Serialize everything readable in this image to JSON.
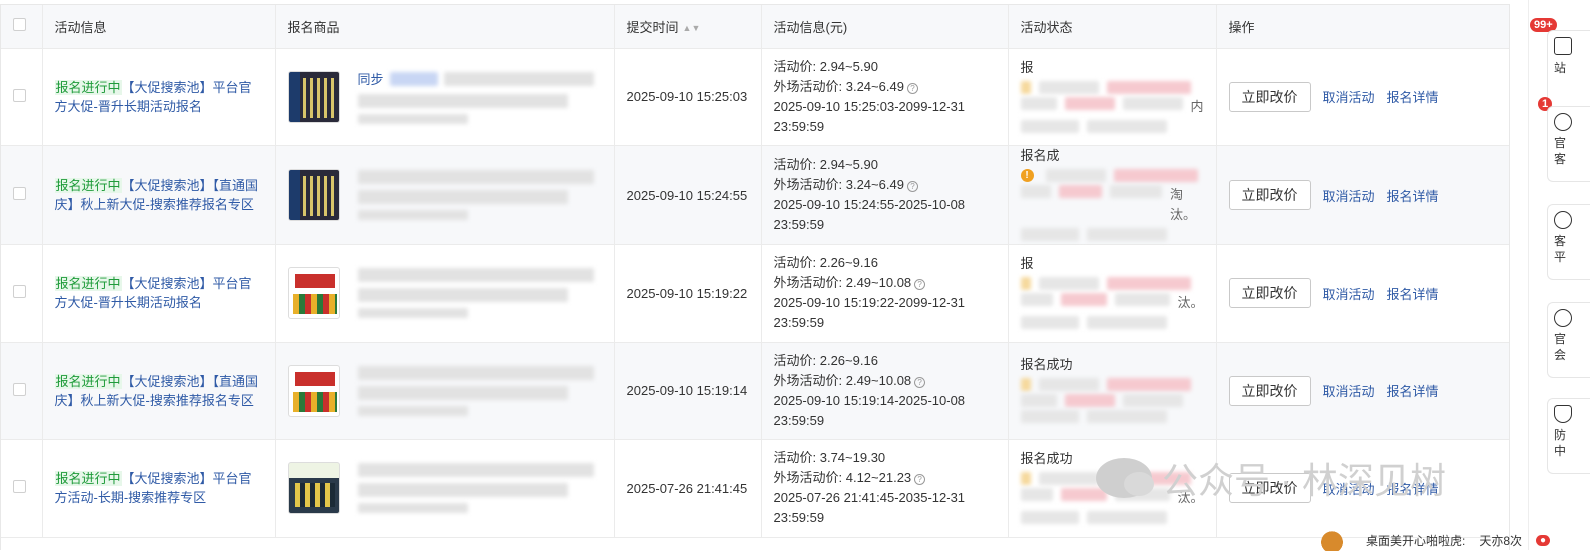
{
  "table": {
    "headers": {
      "activity_info": "活动信息",
      "product": "报名商品",
      "submit_time": "提交时间",
      "activity_price": "活动信息(元)",
      "status": "活动状态",
      "actions": "操作"
    },
    "rows": [
      {
        "tag": "报名进行中",
        "activity": "【大促搜索池】平台官方大促-晋升长期活动报名",
        "product_title_visible": "同步",
        "submit_time": "2025-09-10 15:25:03",
        "price_line": "活动价: 2.94~5.90",
        "outside_price": "外场活动价: 3.24~6.49",
        "period": "2025-09-10 15:25:03-2099-12-31 23:59:59",
        "status_text": "报",
        "status_tail": "内",
        "thumb": "t1",
        "warn": false
      },
      {
        "tag": "报名进行中",
        "activity": "【大促搜索池】【直通国庆】秋上新大促-搜索推荐报名专区",
        "product_title_visible": "",
        "submit_time": "2025-09-10 15:24:55",
        "price_line": "活动价: 2.94~5.90",
        "outside_price": "外场活动价: 3.24~6.49",
        "period": "2025-09-10 15:24:55-2025-10-08 23:59:59",
        "status_text": "报名成",
        "status_tail": "淘汰。",
        "thumb": "t1",
        "warn": true
      },
      {
        "tag": "报名进行中",
        "activity": "【大促搜索池】平台官方大促-晋升长期活动报名",
        "product_title_visible": "",
        "submit_time": "2025-09-10 15:19:22",
        "price_line": "活动价: 2.26~9.16",
        "outside_price": "外场活动价: 2.49~10.08",
        "period": "2025-09-10 15:19:22-2099-12-31 23:59:59",
        "status_text": "报",
        "status_tail": "汰。",
        "thumb": "t2",
        "warn": false
      },
      {
        "tag": "报名进行中",
        "activity": "【大促搜索池】【直通国庆】秋上新大促-搜索推荐报名专区",
        "product_title_visible": "",
        "submit_time": "2025-09-10 15:19:14",
        "price_line": "活动价: 2.26~9.16",
        "outside_price": "外场活动价: 2.49~10.08",
        "period": "2025-09-10 15:19:14-2025-10-08 23:59:59",
        "status_text": "报名成功",
        "status_tail": "",
        "thumb": "t2",
        "warn": false
      },
      {
        "tag": "报名进行中",
        "activity": "【大促搜索池】平台官方活动-长期-搜索推荐专区",
        "product_title_visible": "",
        "submit_time": "2025-07-26 21:41:45",
        "price_line": "活动价: 3.74~19.30",
        "outside_price": "外场活动价: 4.12~21.23",
        "period": "2025-07-26 21:41:45-2035-12-31 23:59:59",
        "status_text": "报名成功",
        "status_tail": "汰。",
        "thumb": "t3",
        "warn": false
      }
    ],
    "actions": {
      "change_price": "立即改价",
      "cancel": "取消活动",
      "details": "报名详情"
    }
  },
  "sidebar": {
    "badge_top": "99+",
    "badge_second": "1",
    "items": [
      "站",
      "官\n客",
      "客\n平",
      "官\n会",
      "防\n中"
    ]
  },
  "watermark": {
    "text": "公众号 · 林深见树"
  },
  "bottom_strip": {
    "text": "桌面美开心啪啦虎:",
    "count": "天亦8次"
  },
  "colors": {
    "link": "#2f5aa6",
    "tag_green": "#1f9b3a",
    "badge_red": "#e53935"
  }
}
